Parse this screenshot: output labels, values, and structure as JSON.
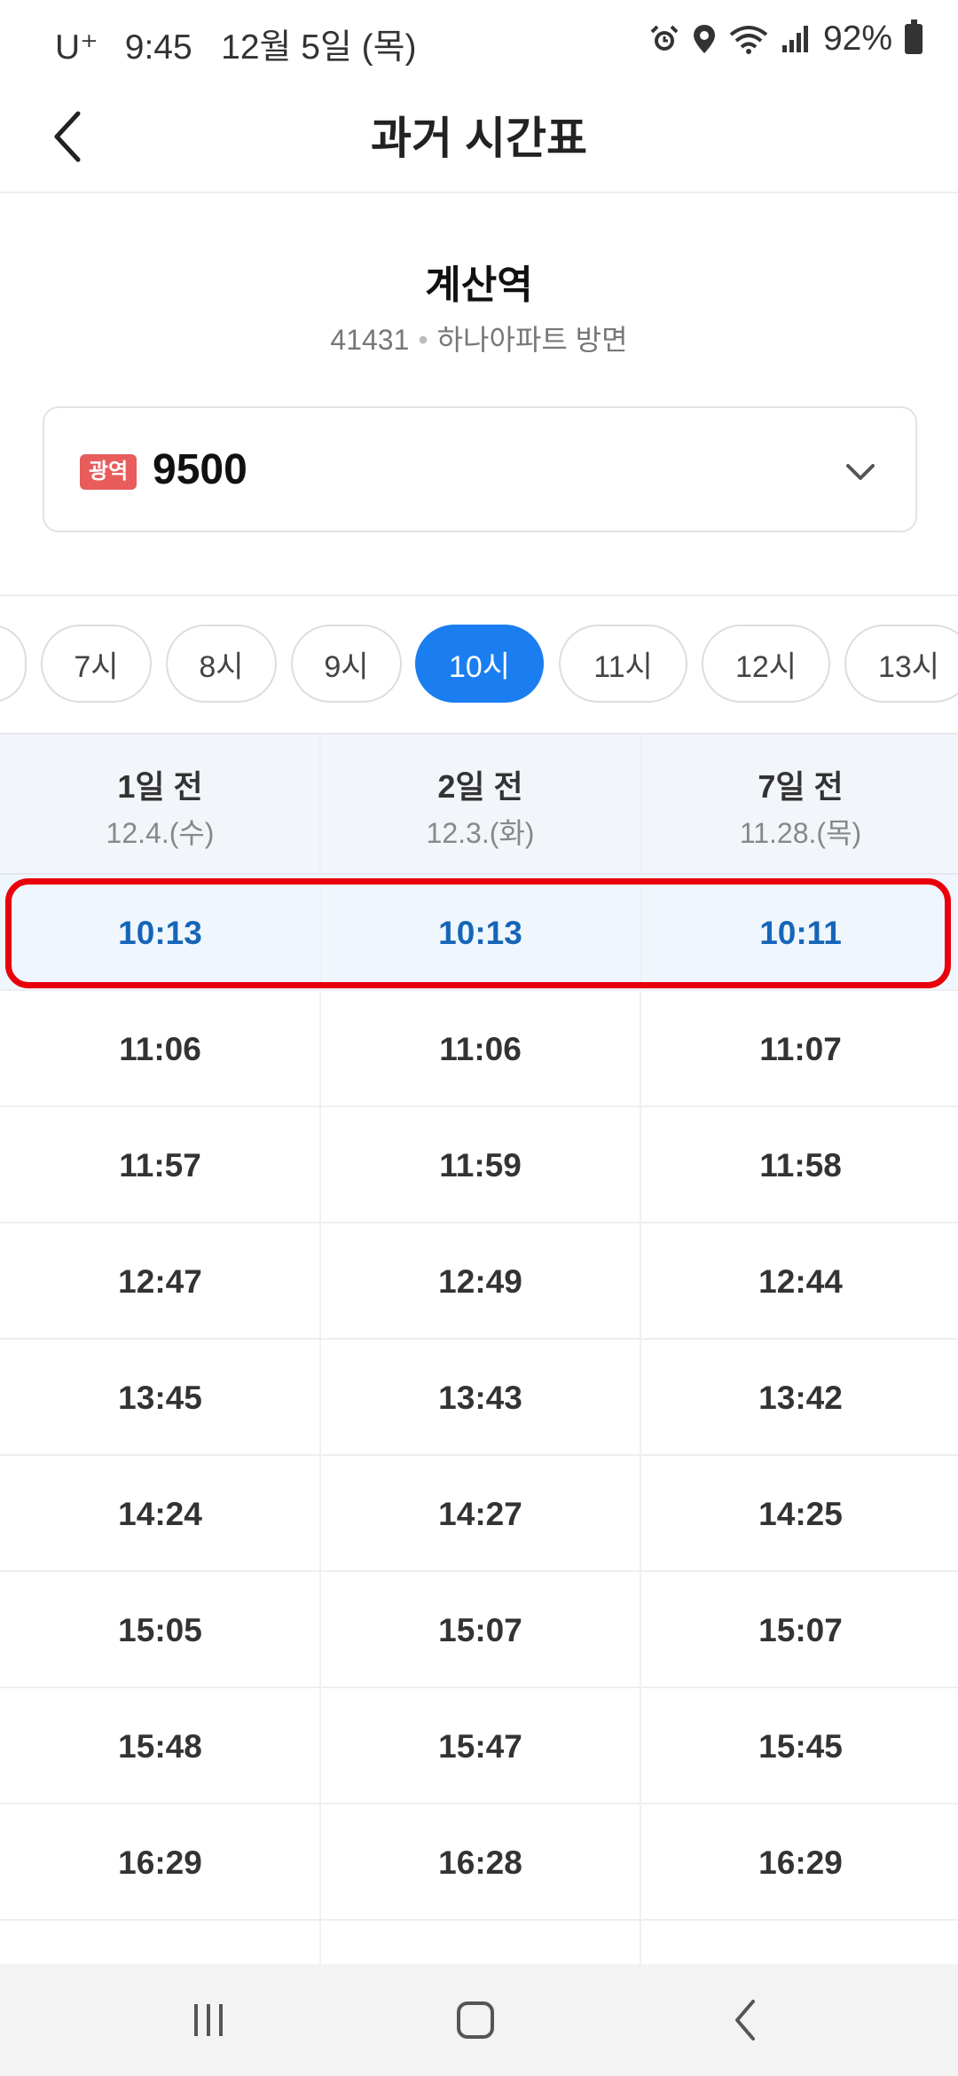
{
  "status_bar": {
    "carrier": "U⁺",
    "time": "9:45",
    "date": "12월 5일 (목)",
    "battery": "92%",
    "icons": [
      "alarm-icon",
      "location-icon",
      "wifi-icon",
      "signal-icon",
      "battery-icon"
    ]
  },
  "header": {
    "title": "과거 시간표",
    "back_icon": "chevron-left-icon"
  },
  "stop": {
    "name": "계산역",
    "id": "41431",
    "direction": "하나아파트 방면"
  },
  "route": {
    "badge": "광역",
    "number": "9500",
    "badge_color": "#e85c5c",
    "dropdown_icon": "chevron-down-icon"
  },
  "hours": {
    "items": [
      "",
      "7시",
      "8시",
      "9시",
      "10시",
      "11시",
      "12시",
      "13시"
    ],
    "selected": "10시",
    "accent_color": "#1a7ef0"
  },
  "timetable": {
    "columns": [
      {
        "day": "1일 전",
        "date": "12.4.(수)"
      },
      {
        "day": "2일 전",
        "date": "12.3.(화)"
      },
      {
        "day": "7일 전",
        "date": "11.28.(목)"
      }
    ],
    "rows": [
      [
        "10:13",
        "10:13",
        "10:11"
      ],
      [
        "11:06",
        "11:06",
        "11:07"
      ],
      [
        "11:57",
        "11:59",
        "11:58"
      ],
      [
        "12:47",
        "12:49",
        "12:44"
      ],
      [
        "13:45",
        "13:43",
        "13:42"
      ],
      [
        "14:24",
        "14:27",
        "14:25"
      ],
      [
        "15:05",
        "15:07",
        "15:07"
      ],
      [
        "15:48",
        "15:47",
        "15:45"
      ],
      [
        "16:29",
        "16:28",
        "16:29"
      ]
    ],
    "highlight_row": 0,
    "highlight_color": "#1566b8",
    "annotation_color": "#e8000b"
  },
  "nav_bar": {
    "icons": [
      "recent-apps-icon",
      "home-icon",
      "back-icon"
    ]
  }
}
